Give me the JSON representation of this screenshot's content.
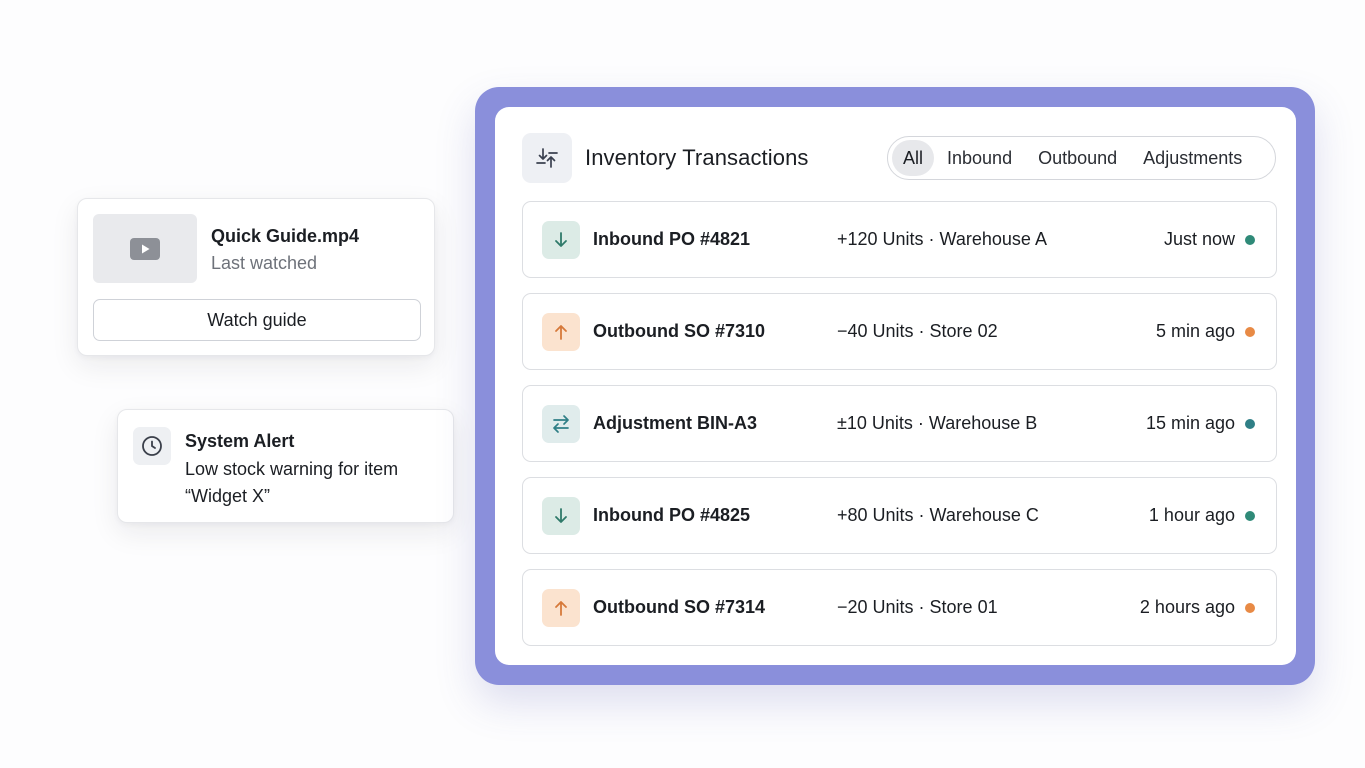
{
  "video": {
    "title": "Quick Guide.mp4",
    "subtitle": "Last watched",
    "button_label": "Watch guide",
    "thumb_icon": "play-icon"
  },
  "alert": {
    "icon": "clock-icon",
    "title": "System Alert",
    "message": "Low stock warning for item “Widget X”"
  },
  "panel": {
    "icon": "transfer-arrows-icon",
    "title": "Inventory Transactions",
    "filters": [
      "All",
      "Inbound",
      "Outbound",
      "Adjustments"
    ],
    "active_filter": "All",
    "accent_color": "#8a8fdb"
  },
  "colors": {
    "inbound": "#2f8a78",
    "outbound": "#e88a45",
    "adjustment": "#2f7f86"
  },
  "transactions": [
    {
      "type": "inbound",
      "icon": "arrow-down-icon",
      "name": "Inbound PO #4821",
      "detail": "+120 Units · Warehouse A",
      "time": "Just now",
      "status_color": "#2f8a78"
    },
    {
      "type": "outbound",
      "icon": "arrow-up-icon",
      "name": "Outbound SO #7310",
      "detail": "−40 Units · Store 02",
      "time": "5 min ago",
      "status_color": "#e88a45"
    },
    {
      "type": "adjustment",
      "icon": "swap-arrows-icon",
      "name": "Adjustment BIN-A3",
      "detail": "±10 Units · Warehouse B",
      "time": "15 min ago",
      "status_color": "#2f7f86"
    },
    {
      "type": "inbound",
      "icon": "arrow-down-icon",
      "name": "Inbound PO #4825",
      "detail": "+80 Units · Warehouse C",
      "time": "1 hour ago",
      "status_color": "#2f8a78"
    },
    {
      "type": "outbound",
      "icon": "arrow-up-icon",
      "name": "Outbound SO #7314",
      "detail": "−20 Units · Store 01",
      "time": "2 hours ago",
      "status_color": "#e88a45"
    }
  ]
}
